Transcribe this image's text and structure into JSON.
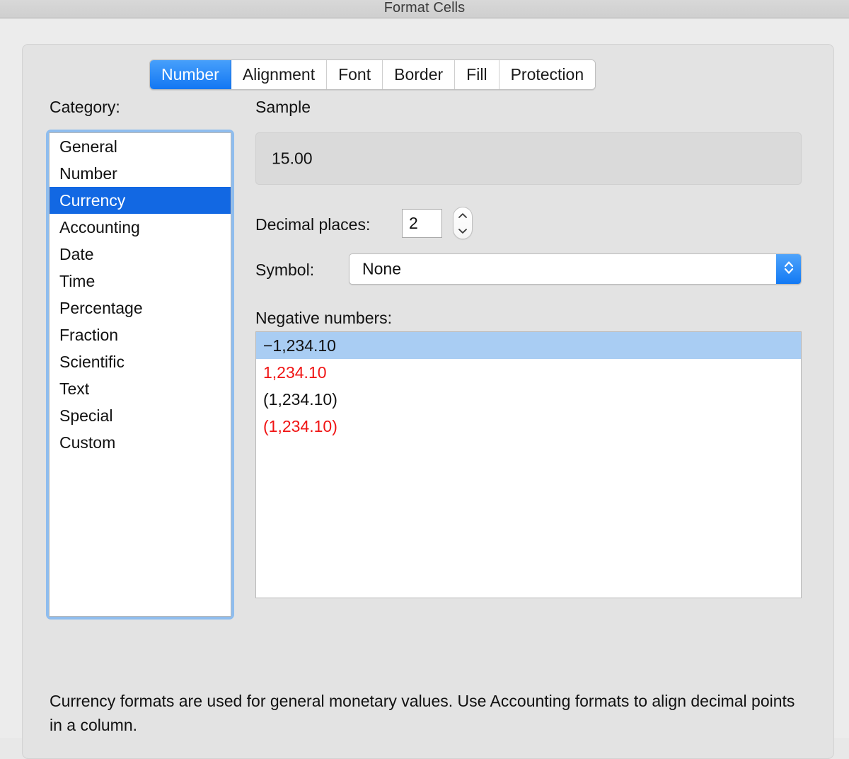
{
  "window": {
    "title": "Format Cells"
  },
  "tabs": [
    {
      "label": "Number",
      "active": true
    },
    {
      "label": "Alignment",
      "active": false
    },
    {
      "label": "Font",
      "active": false
    },
    {
      "label": "Border",
      "active": false
    },
    {
      "label": "Fill",
      "active": false
    },
    {
      "label": "Protection",
      "active": false
    }
  ],
  "category": {
    "label": "Category:",
    "items": [
      "General",
      "Number",
      "Currency",
      "Accounting",
      "Date",
      "Time",
      "Percentage",
      "Fraction",
      "Scientific",
      "Text",
      "Special",
      "Custom"
    ],
    "selected": "Currency"
  },
  "sample": {
    "label": "Sample",
    "value": "15.00"
  },
  "decimal_places": {
    "label": "Decimal places:",
    "value": "2"
  },
  "symbol": {
    "label": "Symbol:",
    "value": "None"
  },
  "negative_numbers": {
    "label": "Negative numbers:",
    "items": [
      {
        "text": "−1,234.10",
        "red": false,
        "selected": true
      },
      {
        "text": "1,234.10",
        "red": true,
        "selected": false
      },
      {
        "text": "(1,234.10)",
        "red": false,
        "selected": false
      },
      {
        "text": "(1,234.10)",
        "red": true,
        "selected": false
      }
    ]
  },
  "description": "Currency formats are used for general monetary values.  Use Accounting formats to align decimal points in a column.",
  "colors": {
    "accent_blue": "#1277f3",
    "selection_blue": "#1268e3",
    "list_selection_light": "#a9cdf3",
    "focus_ring": "#8fbdee",
    "negative_red": "#f01414",
    "dialog_bg": "#ececec",
    "panel_bg": "#e3e3e3"
  }
}
